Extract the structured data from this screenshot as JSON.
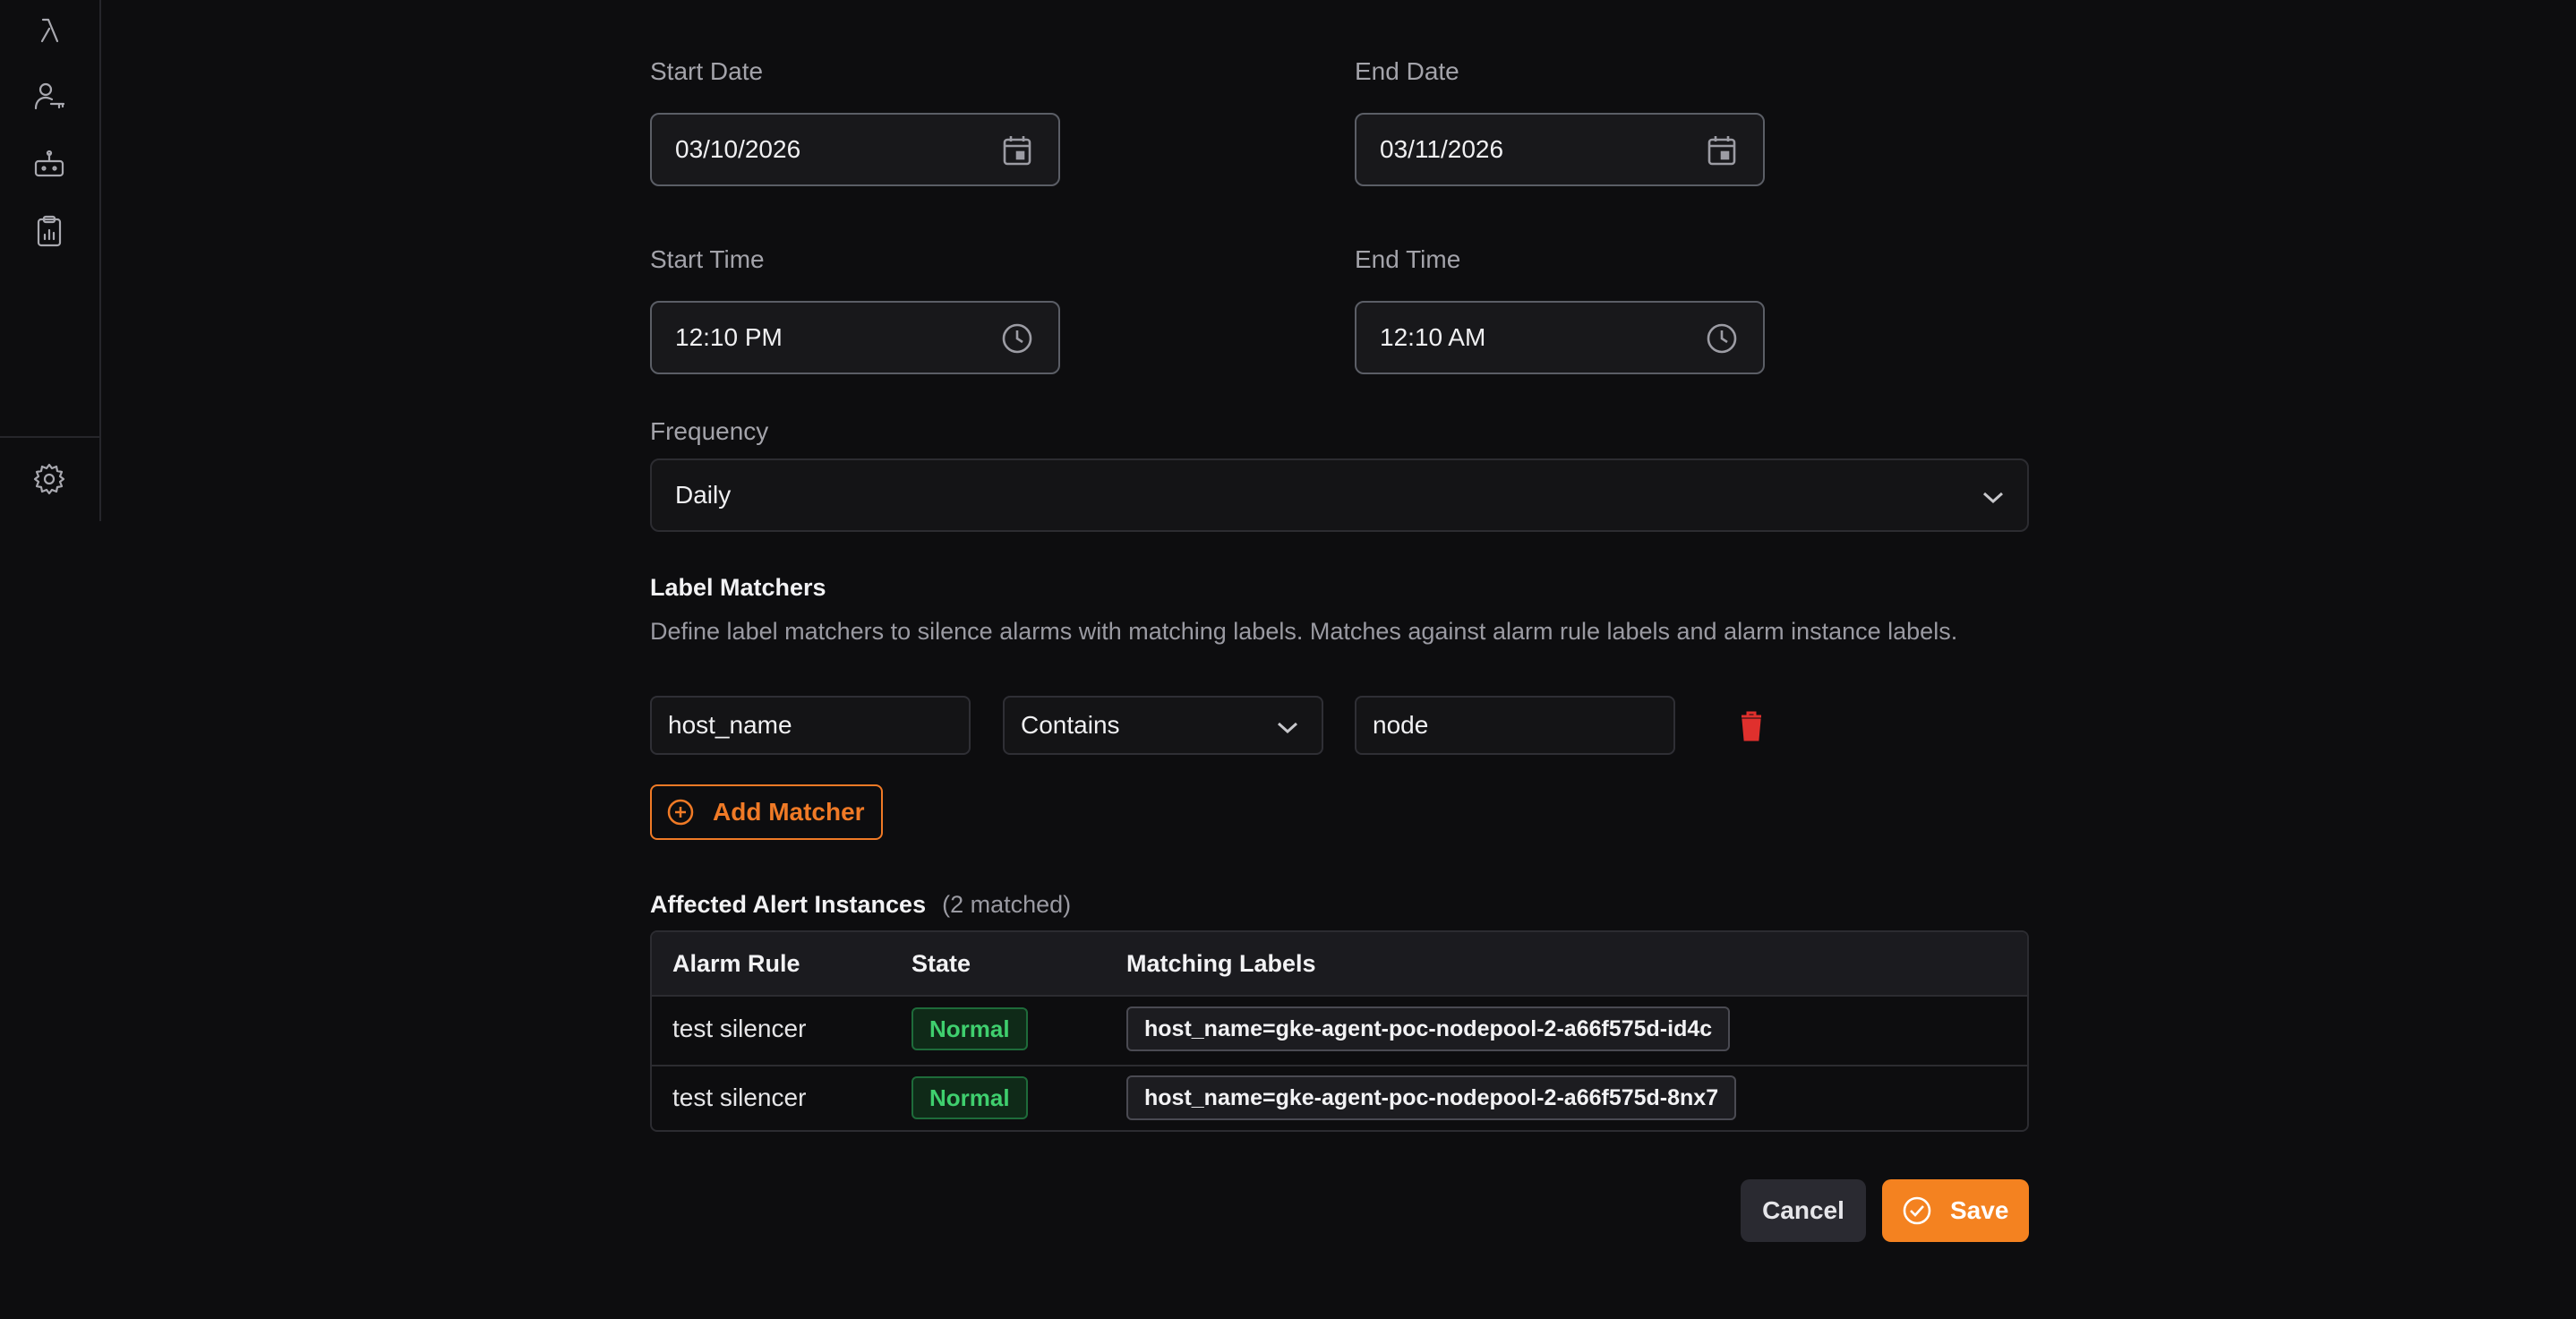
{
  "sidebar": {
    "icons": [
      "lambda-icon",
      "user-key-icon",
      "robot-icon",
      "clipboard-chart-icon",
      "settings-gear-icon"
    ]
  },
  "form": {
    "start_date": {
      "label": "Start Date",
      "value": "03/10/2026"
    },
    "end_date": {
      "label": "End Date",
      "value": "03/11/2026"
    },
    "start_time": {
      "label": "Start Time",
      "value": "12:10 PM"
    },
    "end_time": {
      "label": "End Time",
      "value": "12:10 AM"
    },
    "frequency": {
      "label": "Frequency",
      "value": "Daily"
    }
  },
  "label_matchers": {
    "title": "Label Matchers",
    "description": "Define label matchers to silence alarms with matching labels. Matches against alarm rule labels and alarm instance labels.",
    "matchers": [
      {
        "key": "host_name",
        "operator": "Contains",
        "value": "node"
      }
    ],
    "add_label": "Add Matcher"
  },
  "affected": {
    "title": "Affected Alert Instances",
    "matched": "(2 matched)",
    "columns": [
      "Alarm Rule",
      "State",
      "Matching Labels"
    ],
    "rows": [
      {
        "rule": "test silencer",
        "state": "Normal",
        "labels": "host_name=gke-agent-poc-nodepool-2-a66f575d-id4c"
      },
      {
        "rule": "test silencer",
        "state": "Normal",
        "labels": "host_name=gke-agent-poc-nodepool-2-a66f575d-8nx7"
      }
    ]
  },
  "actions": {
    "cancel": "Cancel",
    "save": "Save"
  },
  "colors": {
    "accent": "#f48220",
    "danger": "#e0302d",
    "success": "#3fcf6e",
    "background": "#0d0d0f"
  }
}
